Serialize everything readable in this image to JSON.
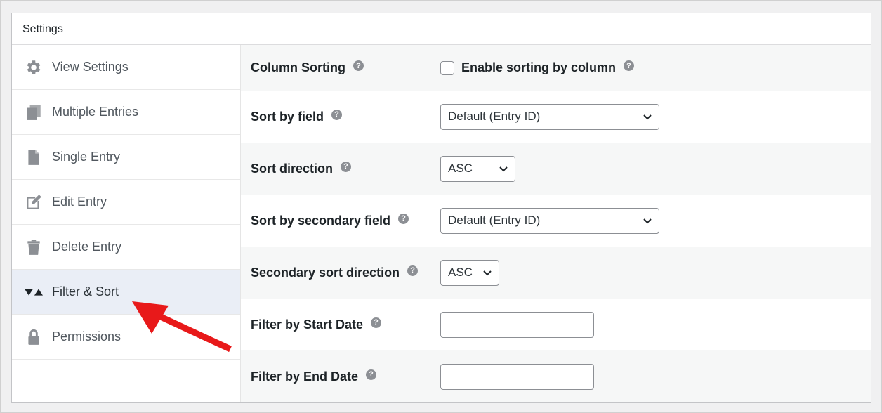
{
  "panel": {
    "title": "Settings"
  },
  "sidebar": {
    "items": [
      {
        "label": "View Settings",
        "icon": "gear-icon",
        "active": false
      },
      {
        "label": "Multiple Entries",
        "icon": "copy-icon",
        "active": false
      },
      {
        "label": "Single Entry",
        "icon": "document-icon",
        "active": false
      },
      {
        "label": "Edit Entry",
        "icon": "edit-icon",
        "active": false
      },
      {
        "label": "Delete Entry",
        "icon": "trash-icon",
        "active": false
      },
      {
        "label": "Filter & Sort",
        "icon": "filter-sort-icon",
        "active": true
      },
      {
        "label": "Permissions",
        "icon": "lock-icon",
        "active": false
      }
    ]
  },
  "settings": {
    "column_sorting": {
      "label": "Column Sorting",
      "checkbox_label": "Enable sorting by column",
      "checked": false
    },
    "sort_by_field": {
      "label": "Sort by field",
      "value": "Default (Entry ID)"
    },
    "sort_direction": {
      "label": "Sort direction",
      "value": "ASC"
    },
    "sort_by_secondary_field": {
      "label": "Sort by secondary field",
      "value": "Default (Entry ID)"
    },
    "secondary_sort_direction": {
      "label": "Secondary sort direction",
      "value": "ASC"
    },
    "filter_start_date": {
      "label": "Filter by Start Date",
      "value": ""
    },
    "filter_end_date": {
      "label": "Filter by End Date",
      "value": ""
    }
  },
  "help_glyph": "?",
  "colors": {
    "annotation_arrow": "#e8191a",
    "active_bg": "#eaeef6",
    "icon": "#8c8f94"
  }
}
